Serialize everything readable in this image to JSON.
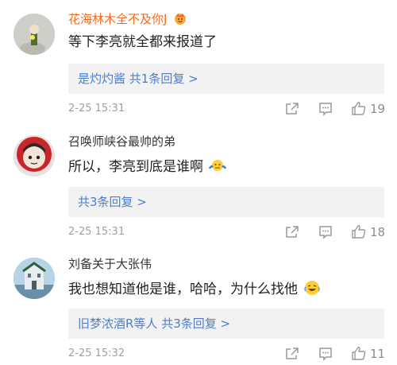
{
  "comments": [
    {
      "author": "花海林木全不及你J",
      "text": "等下李亮就全都来报道了",
      "reply_prefix": "是灼灼酱",
      "reply_link": " 共1条回复 >",
      "time": "2-25 15:31",
      "likes": "19",
      "author_color": "#f26a1f"
    },
    {
      "author": "召唤师峡谷最帅的弟",
      "text": "所以，李亮到底是谁啊",
      "reply_prefix": "",
      "reply_link": "共3条回复 >",
      "time": "2-25 15:31",
      "likes": "18",
      "author_color": "#333333"
    },
    {
      "author": "刘备关于大张伟",
      "text": "我也想知道他是谁，哈哈，为什么找他",
      "reply_prefix": "旧梦浓酒R等人",
      "reply_link": " 共3条回复 >",
      "time": "2-25 15:32",
      "likes": "11",
      "author_color": "#333333"
    }
  ],
  "icons": {
    "share": "share-icon",
    "comment": "comment-icon",
    "like": "thumbs-up-icon",
    "crown": "crown-badge-icon",
    "emoji_shrug": "shrug-emoji-icon",
    "emoji_laugh": "laugh-emoji-icon"
  }
}
